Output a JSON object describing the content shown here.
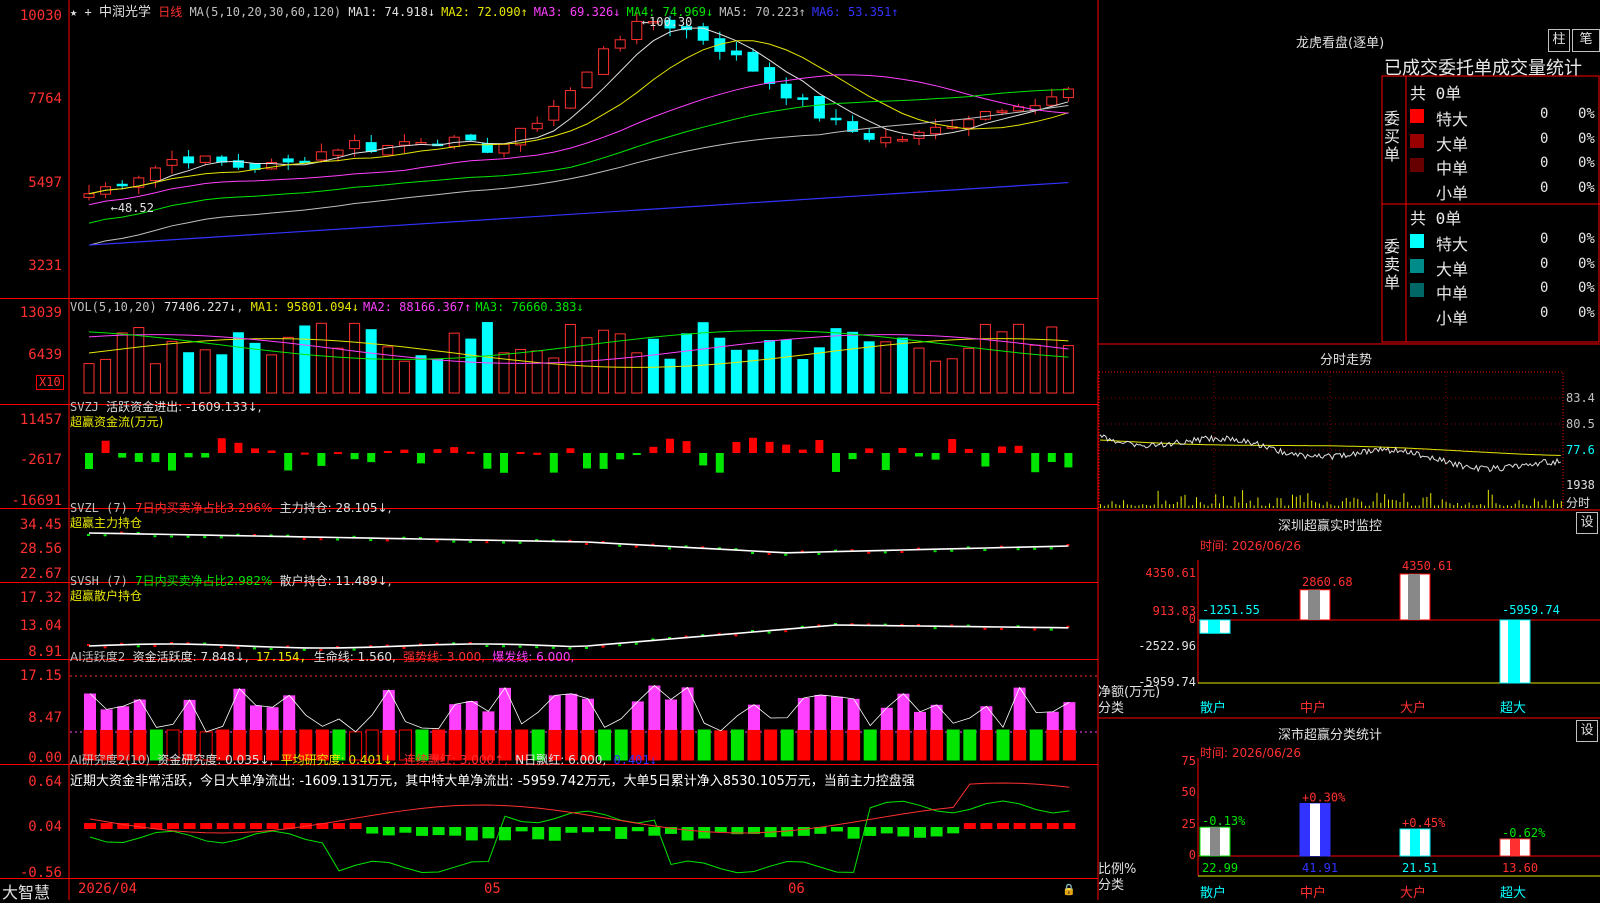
{
  "stock": {
    "name": "中润光学",
    "period": "日线"
  },
  "main": {
    "ma_label": "MA(5,10,20,30,60,120)",
    "ma": [
      {
        "label": "MA1: 74.918↓",
        "color": "#e0e0e0"
      },
      {
        "label": "MA2: 72.090↑",
        "color": "#e6e600"
      },
      {
        "label": "MA3: 69.326↓",
        "color": "#ff40ff"
      },
      {
        "label": "MA4: 74.969↓",
        "color": "#00e600"
      },
      {
        "label": "MA5: 70.223↑",
        "color": "#c0c0c0"
      },
      {
        "label": "MA6: 53.351↑",
        "color": "#3333ff"
      }
    ],
    "yticks": [
      "10030",
      "7764",
      "5497",
      "3231"
    ],
    "high_label": "100.30",
    "low_label": "48.52"
  },
  "vol": {
    "label": "VOL(5,10,20)",
    "value": "77406.227↓",
    "ma": [
      {
        "label": "MA1: 95801.094↓",
        "color": "#e6e600"
      },
      {
        "label": "MA2: 88166.367↑",
        "color": "#ff40ff"
      },
      {
        "label": "MA3: 76660.383↓",
        "color": "#00e600"
      }
    ],
    "yticks": [
      "13039",
      "6439"
    ],
    "unit": "X10"
  },
  "svzj": {
    "label": "SVZJ",
    "l1": "活跃资金进出: -1609.133↓,",
    "l2": "超赢资金流(万元)",
    "yticks": [
      "11457",
      "-2617",
      "-16691"
    ]
  },
  "svzl": {
    "label": "SVZL (7)",
    "l1": "7日内买卖净占比3.296%",
    "l2": "主力持仓: 28.105↓,",
    "l3": "超赢主力持仓",
    "yticks": [
      "34.45",
      "28.56",
      "22.67"
    ]
  },
  "svsh": {
    "label": "SVSH (7)",
    "l1": "7日内买卖净占比2.982%",
    "l2": "散户持仓: 11.489↓,",
    "l3": "超赢散户持仓",
    "yticks": [
      "17.32",
      "13.04",
      "8.91"
    ]
  },
  "ai1": {
    "label": "AI活跃度2",
    "l1": "资金活跃度: 7.848↓,",
    "l2": "17.154,",
    "l3": "生命线: 1.560,",
    "l4": "强势线: 3.000,",
    "l5": "爆发线: 6.000,",
    "yticks": [
      "17.15",
      "8.47",
      "0.00"
    ]
  },
  "ai2": {
    "label": "AI研究度2(10)",
    "l1": "资金研究度: 0.035↓,",
    "l2": "平均研究度: 0.401↓,",
    "l3": "连续飘红: 3.000↑,",
    "l4": "N日飘红: 6.000,",
    "l5": "0.401↓",
    "summary": "近期大资金非常活跃，今日大单净流出: -1609.131万元，其中特大单净流出: -5959.742万元，大单5日累计净入8530.105万元，当前主力控盘强",
    "yticks": [
      "0.64",
      "0.04",
      "-0.56"
    ]
  },
  "xaxis": {
    "labels": [
      "2026/04",
      "05",
      "06"
    ],
    "logo": "大智慧"
  },
  "right": {
    "lh_title": "龙虎看盘(逐单)",
    "btn_zhu": "柱",
    "btn_bi": "笔",
    "tabs": "已成交委托单成交量统计",
    "buy": {
      "side": "委买单",
      "total": "共 0单",
      "rows": [
        {
          "name": "特大",
          "v": "0",
          "p": "0%",
          "color": "#ff0000"
        },
        {
          "name": "大单",
          "v": "0",
          "p": "0%",
          "color": "#990000"
        },
        {
          "name": "中单",
          "v": "0",
          "p": "0%",
          "color": "#660000"
        },
        {
          "name": "小单",
          "v": "0",
          "p": "0%",
          "color": "#000000"
        }
      ]
    },
    "sell": {
      "side": "委卖单",
      "total": "共 0单",
      "rows": [
        {
          "name": "特大",
          "v": "0",
          "p": "0%",
          "color": "#00ffff"
        },
        {
          "name": "大单",
          "v": "0",
          "p": "0%",
          "color": "#008b8b"
        },
        {
          "name": "中单",
          "v": "0",
          "p": "0%",
          "color": "#006666"
        },
        {
          "name": "小单",
          "v": "0",
          "p": "0%",
          "color": "#000000"
        }
      ]
    },
    "minute": {
      "title": "分时走势",
      "yticks": [
        "83.4",
        "80.5",
        "77.6"
      ],
      "vol": "1938",
      "unit": "分时"
    },
    "sz_monitor": {
      "title": "深圳超赢实时监控",
      "btn": "设",
      "time": "时间: 2026/06/26",
      "yticks": [
        "4350.61",
        "913.83",
        "0",
        "-2522.96",
        "-5959.74"
      ],
      "ylabel1": "净额(万元)",
      "ylabel2": "分类",
      "cats": [
        "散户",
        "中户",
        "大户",
        "超大"
      ],
      "values": [
        -1251.55,
        2860.68,
        4350.61,
        -5959.74
      ],
      "labels": [
        "-1251.55",
        "2860.68",
        "4350.61",
        "-5959.74"
      ]
    },
    "sz_class": {
      "title": "深市超赢分类统计",
      "btn": "设",
      "time": "时间: 2026/06/26",
      "yticks": [
        "75",
        "50",
        "25",
        "0"
      ],
      "ylabel1": "比例%",
      "ylabel2": "分类",
      "cats": [
        "散户",
        "中户",
        "大户",
        "超大"
      ],
      "values": [
        22.99,
        41.91,
        21.51,
        13.6
      ],
      "labels": [
        "22.99",
        "41.91",
        "21.51",
        "13.60"
      ],
      "changes": [
        "-0.13%",
        "+0.30%",
        "+0.45%",
        "-0.62%"
      ]
    }
  }
}
